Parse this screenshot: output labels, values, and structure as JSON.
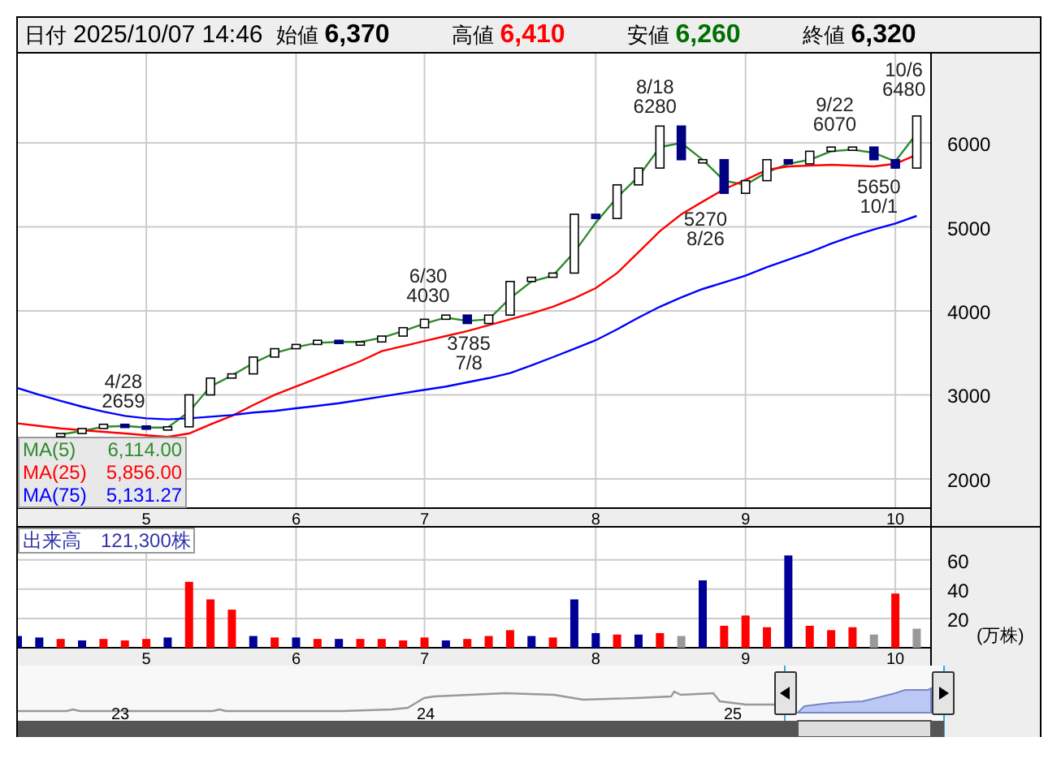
{
  "header": {
    "date_label": "日付",
    "date": "2025/10/07 14:46",
    "quotes": [
      {
        "label": "始値",
        "value": "6,370",
        "color": "#000000"
      },
      {
        "label": "高値",
        "value": "6,410",
        "color": "#ff0000"
      },
      {
        "label": "安値",
        "value": "6,260",
        "color": "#007000"
      },
      {
        "label": "終値",
        "value": "6,320",
        "color": "#000000"
      }
    ]
  },
  "price_chart": {
    "chart_data": {
      "type": "line",
      "categories": [
        null,
        null,
        null,
        null,
        null,
        null,
        "5",
        null,
        null,
        null,
        null,
        null,
        null,
        "6",
        null,
        null,
        null,
        null,
        null,
        "7",
        null,
        null,
        null,
        null,
        null,
        null,
        null,
        "8",
        null,
        null,
        null,
        null,
        null,
        null,
        "9",
        null,
        null,
        null,
        null,
        null,
        null,
        "10",
        null
      ],
      "ylim": [
        1652,
        7063
      ],
      "grid": true,
      "yticks": [
        2000,
        3000,
        4000,
        5000,
        6000
      ],
      "series": [
        {
          "name": "MA(5)",
          "color": "#2e8b2e",
          "values": [
            null,
            null,
            2530,
            2570,
            2620,
            2630,
            2610,
            2610,
            2800,
            3100,
            3230,
            3380,
            3500,
            3570,
            3620,
            3630,
            3630,
            3680,
            3760,
            3850,
            3920,
            3880,
            3900,
            4150,
            4350,
            4420,
            4700,
            5050,
            5350,
            5600,
            5950,
            6000,
            5800,
            5550,
            5500,
            5650,
            5750,
            5800,
            5900,
            5920,
            5880,
            5780,
            6110
          ]
        },
        {
          "name": "MA(25)",
          "color": "#ff0000",
          "values": [
            2660,
            2630,
            2600,
            2580,
            2560,
            2540,
            2520,
            2500,
            2540,
            2650,
            2750,
            2880,
            3000,
            3100,
            3200,
            3300,
            3400,
            3520,
            3580,
            3640,
            3700,
            3760,
            3830,
            3900,
            3970,
            4050,
            4150,
            4270,
            4450,
            4700,
            4950,
            5150,
            5300,
            5450,
            5560,
            5680,
            5720,
            5730,
            5740,
            5730,
            5720,
            5750,
            5860
          ]
        },
        {
          "name": "MA(75)",
          "color": "#0000ff",
          "values": [
            3080,
            3000,
            2930,
            2860,
            2800,
            2750,
            2720,
            2710,
            2720,
            2740,
            2760,
            2790,
            2810,
            2840,
            2870,
            2900,
            2940,
            2980,
            3020,
            3060,
            3100,
            3150,
            3200,
            3260,
            3350,
            3450,
            3550,
            3650,
            3780,
            3920,
            4050,
            4160,
            4260,
            4340,
            4420,
            4520,
            4610,
            4700,
            4800,
            4890,
            4970,
            5040,
            5130
          ]
        }
      ]
    },
    "peaks": [
      {
        "date": "4/28",
        "price": "2659"
      },
      {
        "date": "6/30",
        "price": "4030"
      },
      {
        "date": "7/8",
        "price": "3785"
      },
      {
        "date": "8/18",
        "price": "6280"
      },
      {
        "date": "8/26",
        "price": "5270"
      },
      {
        "date": "9/22",
        "price": "6070"
      },
      {
        "date": "10/1",
        "price": "5650"
      },
      {
        "date": "10/6",
        "price": "6480"
      }
    ],
    "legend_values": [
      "6,114.00",
      "5,856.00",
      "5,131.27"
    ]
  },
  "volume_chart": {
    "title": "出来高",
    "total": "121,300株",
    "unit": "(万株)",
    "chart_data": {
      "type": "bar",
      "stacked": true,
      "categories": [
        null,
        null,
        null,
        null,
        null,
        null,
        "5",
        null,
        null,
        null,
        null,
        null,
        null,
        "6",
        null,
        null,
        null,
        null,
        null,
        "7",
        null,
        null,
        null,
        null,
        null,
        null,
        null,
        "8",
        null,
        null,
        null,
        null,
        null,
        null,
        "9",
        null,
        null,
        null,
        null,
        null,
        null,
        "10",
        null
      ],
      "ylim": [
        0,
        82
      ],
      "grid": true,
      "yticks": [
        20,
        40,
        60
      ],
      "series": [
        {
          "color": "#ff0000",
          "values": [
            null,
            null,
            6,
            null,
            6,
            5,
            6,
            null,
            45,
            33,
            26,
            null,
            7,
            null,
            6,
            null,
            6,
            6,
            5,
            7,
            null,
            6,
            8,
            12,
            null,
            7,
            null,
            null,
            9,
            null,
            10,
            null,
            null,
            15,
            22,
            14,
            null,
            15,
            12,
            14,
            null,
            37,
            null
          ]
        },
        {
          "color": "#000099",
          "values": [
            8,
            7,
            null,
            5,
            null,
            null,
            null,
            7,
            null,
            null,
            null,
            8,
            null,
            7,
            null,
            6,
            null,
            null,
            null,
            null,
            5,
            null,
            null,
            null,
            8,
            null,
            33,
            10,
            null,
            9,
            null,
            null,
            46,
            null,
            null,
            null,
            63,
            null,
            null,
            null,
            null,
            null,
            null
          ]
        },
        {
          "color": "#999999",
          "values": [
            null,
            null,
            null,
            null,
            null,
            null,
            null,
            null,
            null,
            null,
            null,
            null,
            null,
            null,
            null,
            null,
            null,
            null,
            null,
            null,
            null,
            null,
            null,
            null,
            null,
            null,
            null,
            null,
            null,
            null,
            null,
            8,
            null,
            null,
            null,
            null,
            null,
            null,
            null,
            null,
            9,
            null,
            13
          ]
        }
      ]
    }
  },
  "navigator": {
    "labels": [
      "23",
      "24",
      "25"
    ]
  }
}
